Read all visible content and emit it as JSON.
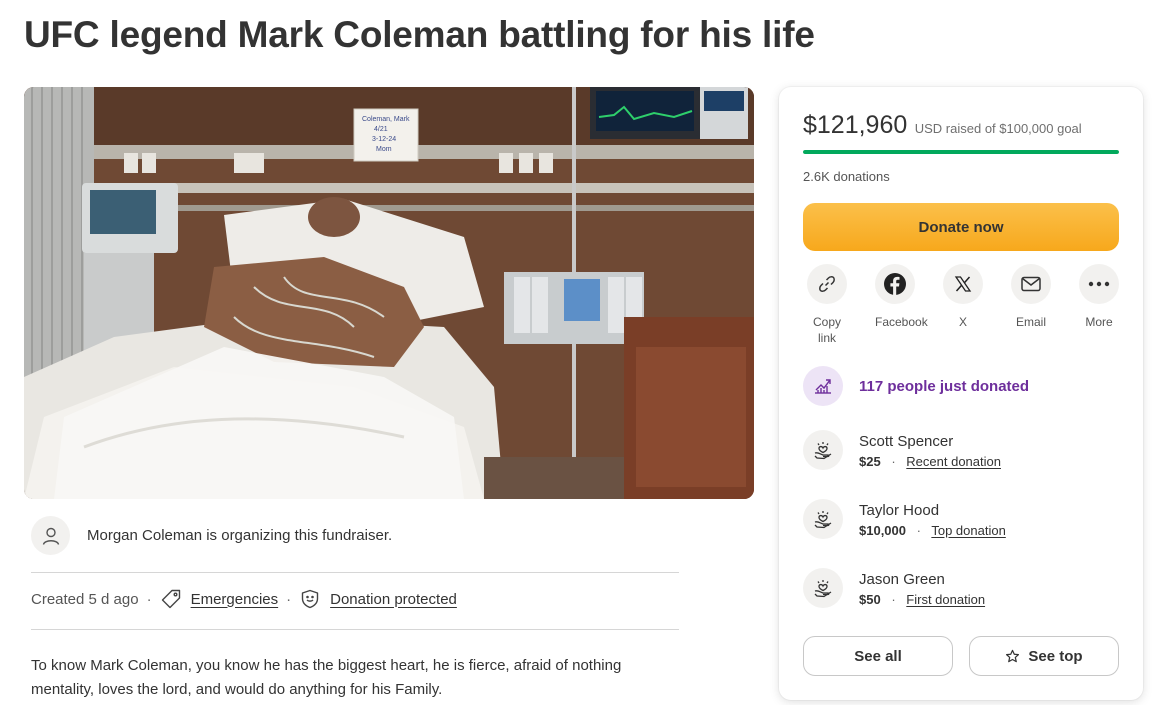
{
  "page": {
    "title": "UFC legend Mark Coleman battling for his life"
  },
  "hero": {
    "image_alt": "Hospital bed photo",
    "whiteboard_lines": [
      "Coleman, Mark",
      "4/21",
      "3-12-24",
      "Mom"
    ]
  },
  "organizer": {
    "text": "Morgan Coleman is organizing this fundraiser.",
    "icon": "person-icon"
  },
  "meta": {
    "created": "Created 5 d ago",
    "separator": "·",
    "category": "Emergencies",
    "category_icon": "tag-icon",
    "protected": "Donation protected",
    "protected_icon": "shield-icon"
  },
  "story": {
    "text": "To know Mark Coleman, you know he has the biggest heart, he is fierce, afraid of nothing mentality, loves the lord, and would do anything for his Family."
  },
  "card": {
    "amount": "$121,960",
    "goal_text": "USD raised of $100,000 goal",
    "progress_fraction": 1.0,
    "donations_count": "2.6K donations",
    "donate_label": "Donate now",
    "share": [
      {
        "label": "Copy link",
        "icon": "link-icon"
      },
      {
        "label": "Facebook",
        "icon": "facebook-icon"
      },
      {
        "label": "X",
        "icon": "x-icon"
      },
      {
        "label": "Email",
        "icon": "email-icon"
      },
      {
        "label": "More",
        "icon": "more-icon"
      }
    ],
    "just_donated": "117 people just donated",
    "donors": [
      {
        "name": "Scott Spencer",
        "amount": "$25",
        "sep": "·",
        "tag": "Recent donation"
      },
      {
        "name": "Taylor Hood",
        "amount": "$10,000",
        "sep": "·",
        "tag": "Top donation"
      },
      {
        "name": "Jason Green",
        "amount": "$50",
        "sep": "·",
        "tag": "First donation"
      }
    ],
    "see_all_label": "See all",
    "see_top_label": "See top"
  },
  "colors": {
    "accent_green": "#02a95c",
    "donate_yellow": "#f7a81c",
    "purple": "#6e2f9c"
  }
}
